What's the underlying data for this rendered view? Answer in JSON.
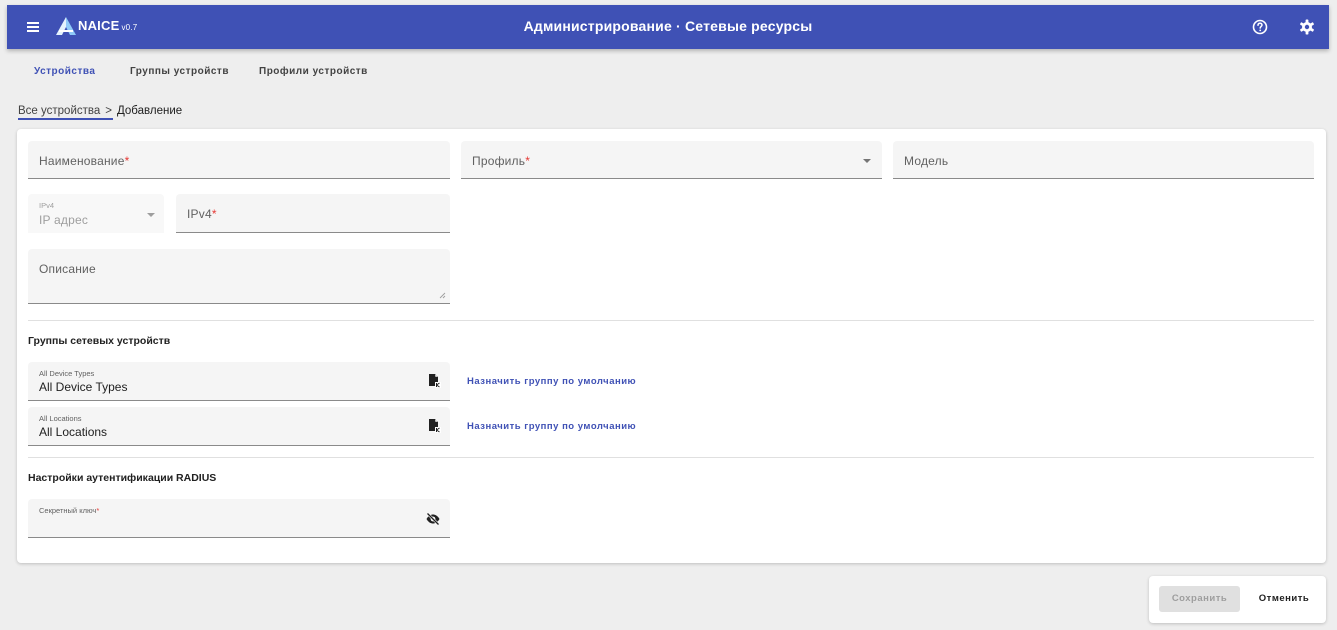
{
  "header": {
    "brand": "NAICE",
    "version": "v0.7",
    "title": "Администрирование · Сетевые ресурсы",
    "menu_icon": "menu-icon",
    "help_icon": "help-circle-icon",
    "settings_icon": "gear-icon",
    "color": "#3f51b5"
  },
  "tabs": [
    {
      "label": "Устройства",
      "active": true
    },
    {
      "label": "Группы устройств",
      "active": false
    },
    {
      "label": "Профили устройств",
      "active": false
    }
  ],
  "breadcrumb": {
    "parent": "Все устройства",
    "separator": ">",
    "current": "Добавление"
  },
  "form": {
    "name": {
      "label": "Наименование",
      "required_mark": "*"
    },
    "profile": {
      "label": "Профиль",
      "required_mark": "*"
    },
    "model": {
      "label": "Модель"
    },
    "ip_type": {
      "small_label": "IPv4",
      "placeholder": "IP адрес"
    },
    "ipv4": {
      "label": "IPv4",
      "required_mark": "*"
    },
    "description": {
      "label": "Описание"
    }
  },
  "groups_section": {
    "title": "Группы сетевых устройств",
    "items": [
      {
        "small_label": "All Device Types",
        "value": "All Device Types",
        "icon": "file-assign-icon",
        "action": "Назначить группу по умолчанию"
      },
      {
        "small_label": "All Locations",
        "value": "All Locations",
        "icon": "file-assign-icon",
        "action": "Назначить группу по умолчанию"
      }
    ]
  },
  "radius_section": {
    "title": "Настройки аутентификации RADIUS",
    "secret": {
      "small_label": "Секретный ключ",
      "required_mark": "*",
      "icon": "eye-off-icon"
    }
  },
  "actions": {
    "save": "Сохранить",
    "cancel": "Отменить"
  }
}
